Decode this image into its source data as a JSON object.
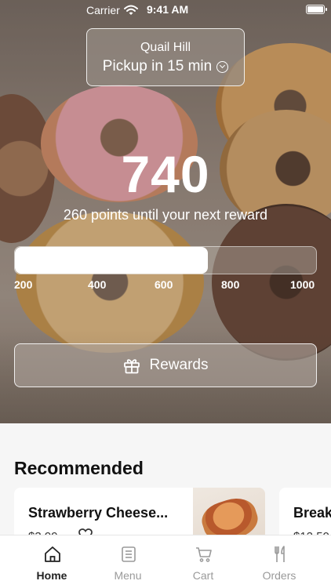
{
  "status_bar": {
    "carrier": "Carrier",
    "time": "9:41 AM"
  },
  "store": {
    "name": "Quail Hill",
    "pickup": "Pickup in 15 min"
  },
  "points": {
    "value": "740",
    "subtitle": "260 points until your next reward",
    "progress_fraction": 0.64,
    "ticks": [
      "200",
      "400",
      "600",
      "800",
      "1000"
    ]
  },
  "rewards_button": {
    "label": "Rewards"
  },
  "recommended": {
    "title": "Recommended",
    "items": [
      {
        "name": "Strawberry Cheese...",
        "price": "$3.99"
      },
      {
        "name": "Break",
        "price": "$12.50"
      }
    ]
  },
  "tabs": [
    {
      "label": "Home",
      "icon": "home-icon",
      "active": true
    },
    {
      "label": "Menu",
      "icon": "menu-icon",
      "active": false
    },
    {
      "label": "Cart",
      "icon": "cart-icon",
      "active": false
    },
    {
      "label": "Orders",
      "icon": "fork-knife-icon",
      "active": false
    }
  ]
}
